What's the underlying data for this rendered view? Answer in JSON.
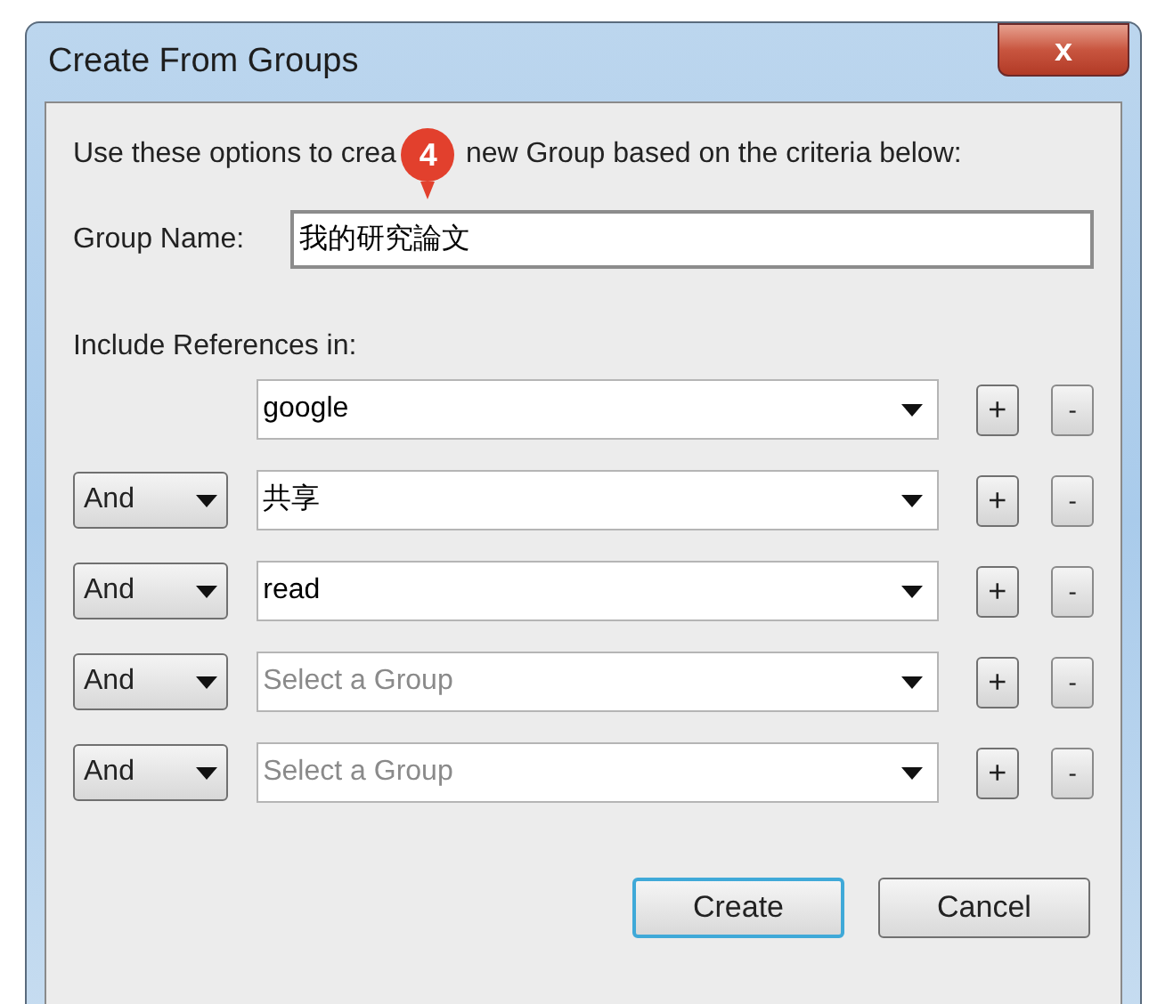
{
  "window": {
    "title": "Create From Groups",
    "close_label": "x"
  },
  "instruction": {
    "before": "Use these options to crea",
    "callout": "4",
    "after": "new Group based on the criteria below:"
  },
  "group_name": {
    "label": "Group Name:",
    "value": "我的研究論文"
  },
  "include_label": "Include References in:",
  "rows": [
    {
      "value": "google",
      "add": "+",
      "remove": "-"
    },
    {
      "connector": "And",
      "value": "共享",
      "add": "+",
      "remove": "-"
    },
    {
      "connector": "And",
      "value": "read",
      "add": "+",
      "remove": "-"
    },
    {
      "connector": "And",
      "placeholder": "Select a Group",
      "add": "+",
      "remove": "-"
    },
    {
      "connector": "And",
      "placeholder": "Select a Group",
      "add": "+",
      "remove": "-"
    }
  ],
  "buttons": [
    {
      "label": "Create",
      "focused": true
    },
    {
      "label": "Cancel",
      "focused": false
    }
  ]
}
